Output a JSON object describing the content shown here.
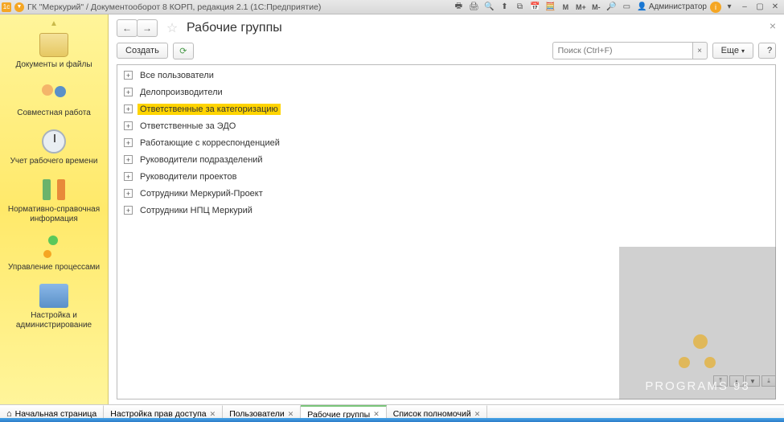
{
  "titlebar": {
    "title": "ГК \"Меркурий\" / Документооборот 8 КОРП, редакция 2.1  (1С:Предприятие)",
    "admin_label": "Администратор",
    "m_labels": [
      "M",
      "M+",
      "M-"
    ]
  },
  "sidebar": {
    "items": [
      {
        "label": "Документы и файлы"
      },
      {
        "label": "Совместная работа"
      },
      {
        "label": "Учет рабочего времени"
      },
      {
        "label": "Нормативно-справочная информация"
      },
      {
        "label": "Управление процессами"
      },
      {
        "label": "Настройка и администрирование"
      }
    ]
  },
  "page": {
    "title": "Рабочие группы",
    "create_label": "Создать",
    "search_placeholder": "Поиск (Ctrl+F)",
    "more_label": "Еще",
    "help_label": "?"
  },
  "tree": {
    "items": [
      {
        "label": "Все пользователи",
        "highlighted": false
      },
      {
        "label": "Делопроизводители",
        "highlighted": false
      },
      {
        "label": "Ответственные за категоризацию",
        "highlighted": true
      },
      {
        "label": "Ответственные за ЭДО",
        "highlighted": false
      },
      {
        "label": "Работающие с корреспонденцией",
        "highlighted": false
      },
      {
        "label": "Руководители подразделений",
        "highlighted": false
      },
      {
        "label": "Руководители проектов",
        "highlighted": false
      },
      {
        "label": "Сотрудники Меркурий-Проект",
        "highlighted": false
      },
      {
        "label": "Сотрудники НПЦ Меркурий",
        "highlighted": false
      }
    ]
  },
  "tabs": {
    "items": [
      {
        "label": "Начальная страница",
        "closable": false,
        "active": false,
        "home": true
      },
      {
        "label": "Настройка прав доступа",
        "closable": true,
        "active": false
      },
      {
        "label": "Пользователи",
        "closable": true,
        "active": false
      },
      {
        "label": "Рабочие группы",
        "closable": true,
        "active": true
      },
      {
        "label": "Список полномочий",
        "closable": true,
        "active": false
      }
    ]
  },
  "watermark": {
    "text": "PROGRAMS 93"
  }
}
